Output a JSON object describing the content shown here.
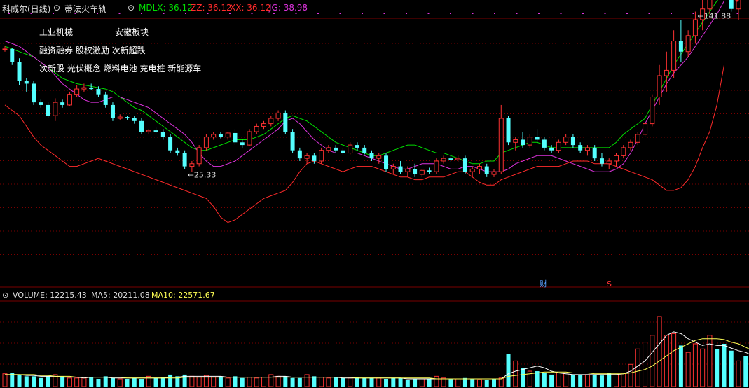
{
  "header": {
    "stock_title": "科威尔(日线)",
    "indicator_name": "蒂法火车轨",
    "mdlx_label": "MDLX: 36.12",
    "zz_label": "ZZ: 36.12",
    "xx_label": "XX: 36.12",
    "jg_label": "JG: 38.98"
  },
  "concepts": {
    "line1_a": "工业机械",
    "line1_b": "安徽板块",
    "line2": "融资融券 股权激励 次新超跌",
    "line3": "次新股 光伏概念 燃料电池 充电桩 新能源车"
  },
  "annotations": {
    "high_label": "141.88",
    "low_label": "25.33",
    "marker_cai": "财",
    "marker_s": "S"
  },
  "volume_header": {
    "volume_label": "VOLUME: 12215.43",
    "ma5_label": "MA5: 20211.08",
    "ma10_label": "MA10: 22571.67"
  },
  "colors": {
    "up": "#ff3232",
    "down": "#54ffff",
    "mdlx": "#00dd00",
    "zz": "#ff2b2b",
    "xx": "#ff2b2b",
    "jg": "#dd33dd",
    "ma5": "#ffffff",
    "ma10": "#ffff55",
    "grid": "#7a0000"
  },
  "chart_data": [
    {
      "type": "candlestick",
      "title": "科威尔(日线)",
      "ylim": [
        10,
        160
      ],
      "ohlc": [
        [
          82,
          84,
          80,
          82
        ],
        [
          82,
          83,
          70,
          72
        ],
        [
          72,
          75,
          55,
          58
        ],
        [
          58,
          60,
          50,
          56
        ],
        [
          56,
          58,
          40,
          42
        ],
        [
          42,
          44,
          38,
          40
        ],
        [
          40,
          42,
          30,
          32
        ],
        [
          32,
          45,
          28,
          42
        ],
        [
          42,
          44,
          38,
          40
        ],
        [
          40,
          50,
          39,
          48
        ],
        [
          48,
          55,
          46,
          52
        ],
        [
          52,
          56,
          50,
          53
        ],
        [
          53,
          56,
          51,
          52
        ],
        [
          52,
          54,
          46,
          48
        ],
        [
          48,
          50,
          38,
          40
        ],
        [
          40,
          42,
          28,
          30
        ],
        [
          30,
          33,
          29,
          31
        ],
        [
          31,
          32,
          29,
          30
        ],
        [
          30,
          32,
          26,
          28
        ],
        [
          28,
          30,
          18,
          20
        ],
        [
          20,
          22,
          18,
          21
        ],
        [
          21,
          23,
          19,
          20
        ],
        [
          20,
          22,
          14,
          16
        ],
        [
          16,
          18,
          4,
          6
        ],
        [
          6,
          8,
          2,
          4
        ],
        [
          4,
          6,
          -8,
          -6
        ],
        [
          -6,
          -2,
          -10,
          -4
        ],
        [
          -4,
          10,
          -6,
          8
        ],
        [
          8,
          18,
          6,
          16
        ],
        [
          16,
          20,
          14,
          18
        ],
        [
          18,
          20,
          15,
          16
        ],
        [
          16,
          20,
          14,
          19
        ],
        [
          19,
          22,
          10,
          12
        ],
        [
          12,
          14,
          8,
          10
        ],
        [
          10,
          22,
          9,
          20
        ],
        [
          20,
          26,
          18,
          24
        ],
        [
          24,
          28,
          22,
          26
        ],
        [
          26,
          32,
          24,
          30
        ],
        [
          30,
          36,
          28,
          34
        ],
        [
          34,
          36,
          18,
          20
        ],
        [
          20,
          22,
          4,
          6
        ],
        [
          6,
          8,
          -2,
          0
        ],
        [
          0,
          4,
          -4,
          2
        ],
        [
          2,
          4,
          -4,
          -2
        ],
        [
          -2,
          8,
          -4,
          6
        ],
        [
          6,
          10,
          4,
          8
        ],
        [
          8,
          10,
          4,
          6
        ],
        [
          6,
          8,
          3,
          4
        ],
        [
          4,
          12,
          3,
          10
        ],
        [
          10,
          12,
          6,
          8
        ],
        [
          8,
          10,
          3,
          4
        ],
        [
          4,
          6,
          -2,
          0
        ],
        [
          0,
          4,
          -4,
          2
        ],
        [
          2,
          4,
          -10,
          -8
        ],
        [
          -8,
          -4,
          -12,
          -6
        ],
        [
          -6,
          -2,
          -12,
          -10
        ],
        [
          -10,
          -6,
          -14,
          -8
        ],
        [
          -8,
          -4,
          -14,
          -12
        ],
        [
          -12,
          -8,
          -14,
          -9
        ],
        [
          -9,
          -7,
          -12,
          -10
        ],
        [
          -10,
          0,
          -12,
          -2
        ],
        [
          -2,
          2,
          -4,
          0
        ],
        [
          0,
          2,
          -3,
          -1
        ],
        [
          -1,
          2,
          -3,
          0
        ],
        [
          0,
          2,
          -12,
          -10
        ],
        [
          -10,
          -6,
          -14,
          -8
        ],
        [
          -8,
          -4,
          -12,
          -6
        ],
        [
          -6,
          -4,
          -14,
          -12
        ],
        [
          -12,
          -8,
          -14,
          -10
        ],
        [
          -10,
          40,
          -12,
          30
        ],
        [
          30,
          32,
          10,
          12
        ],
        [
          12,
          16,
          6,
          14
        ],
        [
          14,
          20,
          8,
          10
        ],
        [
          10,
          18,
          8,
          16
        ],
        [
          16,
          22,
          12,
          14
        ],
        [
          14,
          16,
          6,
          8
        ],
        [
          8,
          10,
          4,
          6
        ],
        [
          6,
          14,
          4,
          12
        ],
        [
          12,
          18,
          10,
          16
        ],
        [
          16,
          18,
          8,
          10
        ],
        [
          10,
          12,
          4,
          6
        ],
        [
          6,
          10,
          2,
          8
        ],
        [
          8,
          10,
          -2,
          0
        ],
        [
          0,
          4,
          -6,
          -4
        ],
        [
          -4,
          0,
          -8,
          -2
        ],
        [
          -2,
          4,
          -6,
          2
        ],
        [
          2,
          10,
          0,
          8
        ],
        [
          8,
          14,
          6,
          12
        ],
        [
          12,
          20,
          10,
          18
        ],
        [
          18,
          28,
          16,
          26
        ],
        [
          26,
          48,
          24,
          46
        ],
        [
          46,
          70,
          40,
          62
        ],
        [
          62,
          80,
          50,
          66
        ],
        [
          66,
          96,
          60,
          88
        ],
        [
          88,
          104,
          72,
          80
        ],
        [
          80,
          96,
          76,
          92
        ],
        [
          92,
          110,
          86,
          104
        ],
        [
          104,
          120,
          96,
          112
        ],
        [
          112,
          150,
          108,
          146
        ],
        [
          146,
          148,
          126,
          128
        ],
        [
          128,
          132,
          118,
          120
        ],
        [
          120,
          124,
          110,
          112
        ],
        [
          112,
          128,
          104,
          124
        ]
      ],
      "series": [
        {
          "name": "MDLX",
          "y": [
            84,
            82,
            80,
            78,
            76,
            72,
            68,
            64,
            60,
            58,
            56,
            55,
            54,
            53,
            52,
            50,
            46,
            42,
            38,
            36,
            32,
            28,
            24,
            20,
            16,
            12,
            8,
            6,
            6,
            8,
            10,
            12,
            14,
            14,
            14,
            16,
            18,
            22,
            26,
            30,
            32,
            30,
            28,
            24,
            20,
            16,
            12,
            10,
            8,
            6,
            4,
            2,
            2,
            4,
            6,
            8,
            10,
            10,
            8,
            6,
            4,
            4,
            2,
            0,
            -2,
            -4,
            -4,
            -2,
            -2,
            4,
            6,
            8,
            10,
            12,
            12,
            10,
            8,
            8,
            8,
            8,
            8,
            8,
            8,
            8,
            8,
            12,
            18,
            22,
            26,
            30,
            40,
            50,
            60,
            70,
            78,
            86,
            94,
            102,
            110,
            118,
            124
          ]
        },
        {
          "name": "JG",
          "y": [
            88,
            86,
            84,
            80,
            76,
            72,
            68,
            62,
            56,
            52,
            48,
            44,
            42,
            42,
            44,
            46,
            46,
            44,
            42,
            40,
            38,
            34,
            30,
            26,
            22,
            18,
            12,
            4,
            -2,
            -6,
            -6,
            -4,
            -2,
            2,
            6,
            10,
            14,
            18,
            22,
            28,
            30,
            26,
            20,
            14,
            10,
            6,
            4,
            4,
            4,
            4,
            2,
            0,
            -2,
            -4,
            -6,
            -8,
            -8,
            -6,
            -4,
            -4,
            -4,
            -6,
            -8,
            -8,
            -6,
            -6,
            -8,
            -10,
            -10,
            -10,
            -8,
            -4,
            -2,
            0,
            2,
            2,
            2,
            0,
            -2,
            -4,
            -6,
            -8,
            -10,
            -10,
            -10,
            -8,
            -4,
            4,
            14,
            26,
            36,
            46,
            56,
            64,
            70,
            76,
            84,
            92,
            100,
            108,
            118
          ]
        },
        {
          "name": "ZZ",
          "y": [
            40,
            36,
            32,
            24,
            16,
            10,
            6,
            2,
            -2,
            -6,
            -6,
            -4,
            -2,
            0,
            -2,
            -4,
            -6,
            -8,
            -10,
            -12,
            -14,
            -16,
            -18,
            -20,
            -22,
            -24,
            -26,
            -28,
            -30,
            -36,
            -44,
            -48,
            -46,
            -42,
            -38,
            -34,
            -30,
            -28,
            -26,
            -24,
            -18,
            -10,
            -4,
            -2,
            -4,
            -6,
            -8,
            -10,
            -8,
            -6,
            -6,
            -6,
            -8,
            -10,
            -12,
            -14,
            -14,
            -16,
            -16,
            -14,
            -14,
            -14,
            -12,
            -10,
            -10,
            -14,
            -18,
            -20,
            -20,
            -16,
            -14,
            -12,
            -10,
            -8,
            -6,
            -6,
            -6,
            -6,
            -4,
            -2,
            -2,
            -2,
            -4,
            -4,
            -4,
            -6,
            -8,
            -10,
            -12,
            -14,
            -16,
            -20,
            -24,
            -24,
            -22,
            -16,
            -6,
            8,
            20,
            40,
            70
          ]
        }
      ]
    },
    {
      "type": "bar",
      "title": "VOLUME",
      "ylim": [
        0,
        100
      ],
      "values": [
        15,
        16,
        14,
        12,
        12,
        10,
        12,
        14,
        12,
        10,
        10,
        10,
        11,
        9,
        12,
        10,
        9,
        9,
        10,
        9,
        12,
        10,
        11,
        14,
        12,
        14,
        12,
        11,
        13,
        11,
        12,
        10,
        12,
        10,
        11,
        10,
        11,
        14,
        12,
        12,
        10,
        10,
        14,
        12,
        11,
        10,
        11,
        10,
        10,
        11,
        10,
        10,
        10,
        9,
        10,
        10,
        8,
        9,
        9,
        9,
        12,
        10,
        9,
        9,
        10,
        9,
        8,
        8,
        9,
        10,
        38,
        30,
        22,
        18,
        18,
        16,
        14,
        16,
        16,
        14,
        14,
        14,
        14,
        13,
        16,
        14,
        16,
        26,
        44,
        52,
        60,
        82,
        60,
        62,
        48,
        40,
        50,
        44,
        60,
        44,
        50,
        42,
        30,
        36,
        30
      ],
      "up": [
        1,
        0,
        0,
        0,
        0,
        0,
        0,
        1,
        0,
        1,
        1,
        1,
        0,
        0,
        0,
        0,
        1,
        0,
        0,
        0,
        1,
        0,
        0,
        0,
        0,
        0,
        1,
        1,
        1,
        1,
        0,
        1,
        0,
        0,
        1,
        1,
        1,
        1,
        1,
        0,
        0,
        0,
        1,
        0,
        1,
        1,
        0,
        0,
        1,
        0,
        0,
        0,
        1,
        0,
        0,
        0,
        0,
        0,
        1,
        0,
        1,
        1,
        0,
        1,
        0,
        0,
        1,
        0,
        0,
        1,
        0,
        1,
        0,
        1,
        0,
        0,
        0,
        1,
        1,
        0,
        0,
        1,
        0,
        0,
        0,
        1,
        1,
        1,
        1,
        1,
        1,
        1,
        1,
        1,
        0,
        1,
        1,
        1,
        1,
        0,
        0,
        0,
        1,
        0,
        1
      ],
      "series": [
        {
          "name": "MA5",
          "values": [
            14,
            14,
            14,
            13,
            13,
            12,
            12,
            12,
            11,
            11,
            11,
            10,
            11,
            11,
            11,
            10,
            10,
            10,
            10,
            10,
            10,
            10,
            10,
            11,
            11,
            12,
            12,
            12,
            12,
            12,
            12,
            11,
            11,
            11,
            11,
            11,
            11,
            11,
            12,
            12,
            11,
            11,
            11,
            11,
            11,
            11,
            11,
            10,
            10,
            10,
            10,
            10,
            10,
            10,
            10,
            10,
            9,
            9,
            9,
            9,
            9,
            9,
            9,
            9,
            9,
            9,
            9,
            9,
            9,
            9,
            15,
            18,
            20,
            22,
            24,
            22,
            18,
            16,
            15,
            14,
            14,
            14,
            14,
            14,
            14,
            14,
            15,
            18,
            24,
            30,
            40,
            50,
            60,
            64,
            62,
            56,
            52,
            48,
            50,
            48,
            48,
            45,
            42,
            40,
            36
          ]
        },
        {
          "name": "MA10",
          "values": [
            14,
            14,
            14,
            14,
            14,
            13,
            13,
            12,
            12,
            12,
            11,
            11,
            11,
            11,
            11,
            11,
            11,
            10,
            10,
            10,
            10,
            10,
            10,
            10,
            10,
            11,
            11,
            11,
            11,
            11,
            11,
            11,
            11,
            11,
            11,
            11,
            11,
            11,
            11,
            11,
            11,
            11,
            11,
            11,
            11,
            11,
            11,
            11,
            11,
            10,
            10,
            10,
            10,
            10,
            10,
            10,
            10,
            10,
            10,
            10,
            9,
            9,
            9,
            9,
            9,
            9,
            9,
            9,
            9,
            9,
            12,
            13,
            14,
            15,
            16,
            17,
            17,
            17,
            17,
            16,
            16,
            16,
            15,
            15,
            15,
            15,
            15,
            16,
            18,
            20,
            24,
            30,
            36,
            42,
            46,
            50,
            54,
            56,
            56,
            56,
            55,
            52,
            50,
            46,
            42
          ]
        }
      ]
    }
  ]
}
